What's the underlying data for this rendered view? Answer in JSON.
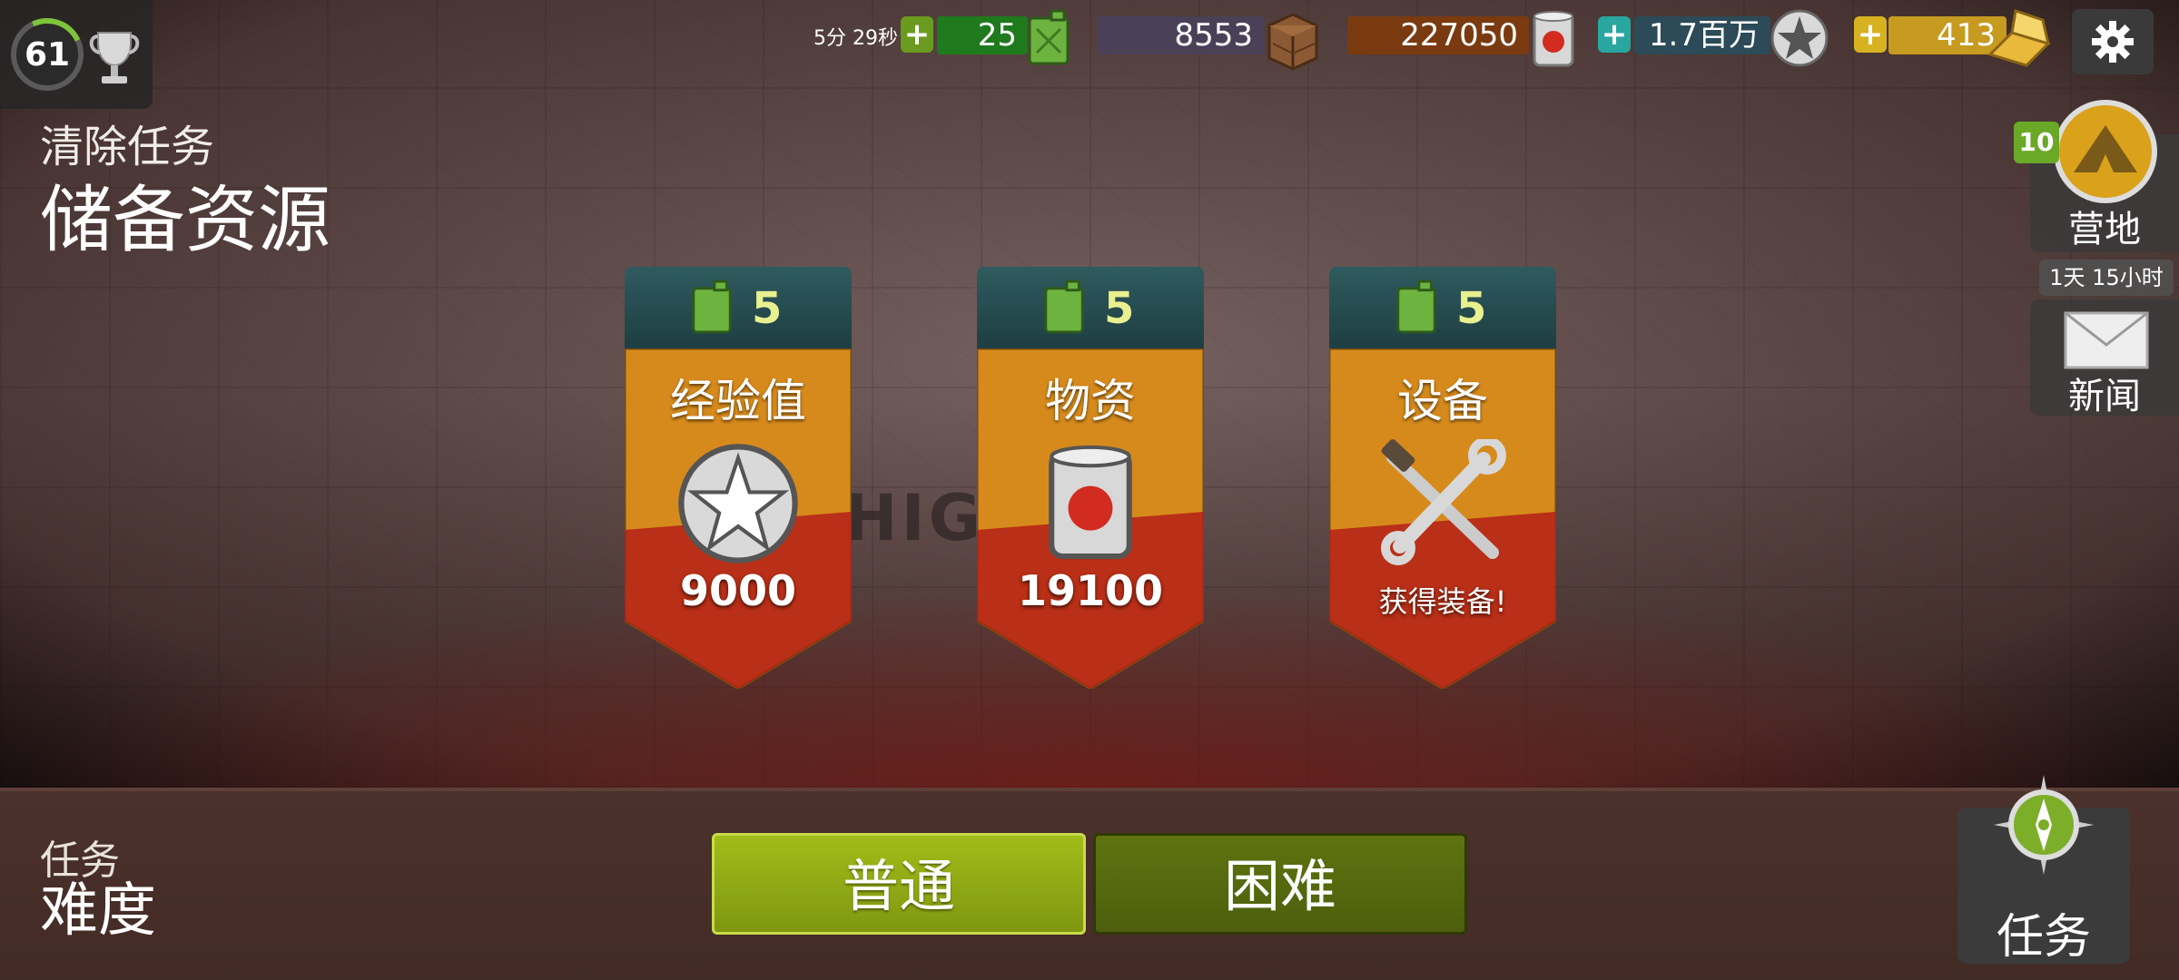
{
  "player": {
    "level": "61"
  },
  "mission": {
    "subtitle": "清除任务",
    "title": "储备资源"
  },
  "resources": {
    "timer": "5分 29秒",
    "fuel": "25",
    "crates": "8553",
    "food": "227050",
    "xp": "1.7百万",
    "gold": "413"
  },
  "side": {
    "camp_badge": "10",
    "camp_label": "营地",
    "news_time": "1天 15小时",
    "news_label": "新闻"
  },
  "map_label": "HIGHW",
  "cards": [
    {
      "cost": "5",
      "title": "经验值",
      "value": "9000",
      "icon": "xp-badge-icon"
    },
    {
      "cost": "5",
      "title": "物资",
      "value": "19100",
      "icon": "tomato-can-icon"
    },
    {
      "cost": "5",
      "title": "设备",
      "note": "获得装备!",
      "icon": "tools-icon"
    }
  ],
  "difficulty": {
    "label_top": "任务",
    "label_bottom": "难度",
    "normal": "普通",
    "hard": "困难"
  },
  "missions_button": "任务",
  "colors": {
    "fuel_bar": "#1f7a1e",
    "crates_bar": "#4a4158",
    "food_bar": "#7a3a10",
    "xp_bar": "#2c4a58",
    "gold_bar": "#c79a20",
    "card_orange": "#d68a1c",
    "card_teal": "#1d3e42"
  }
}
